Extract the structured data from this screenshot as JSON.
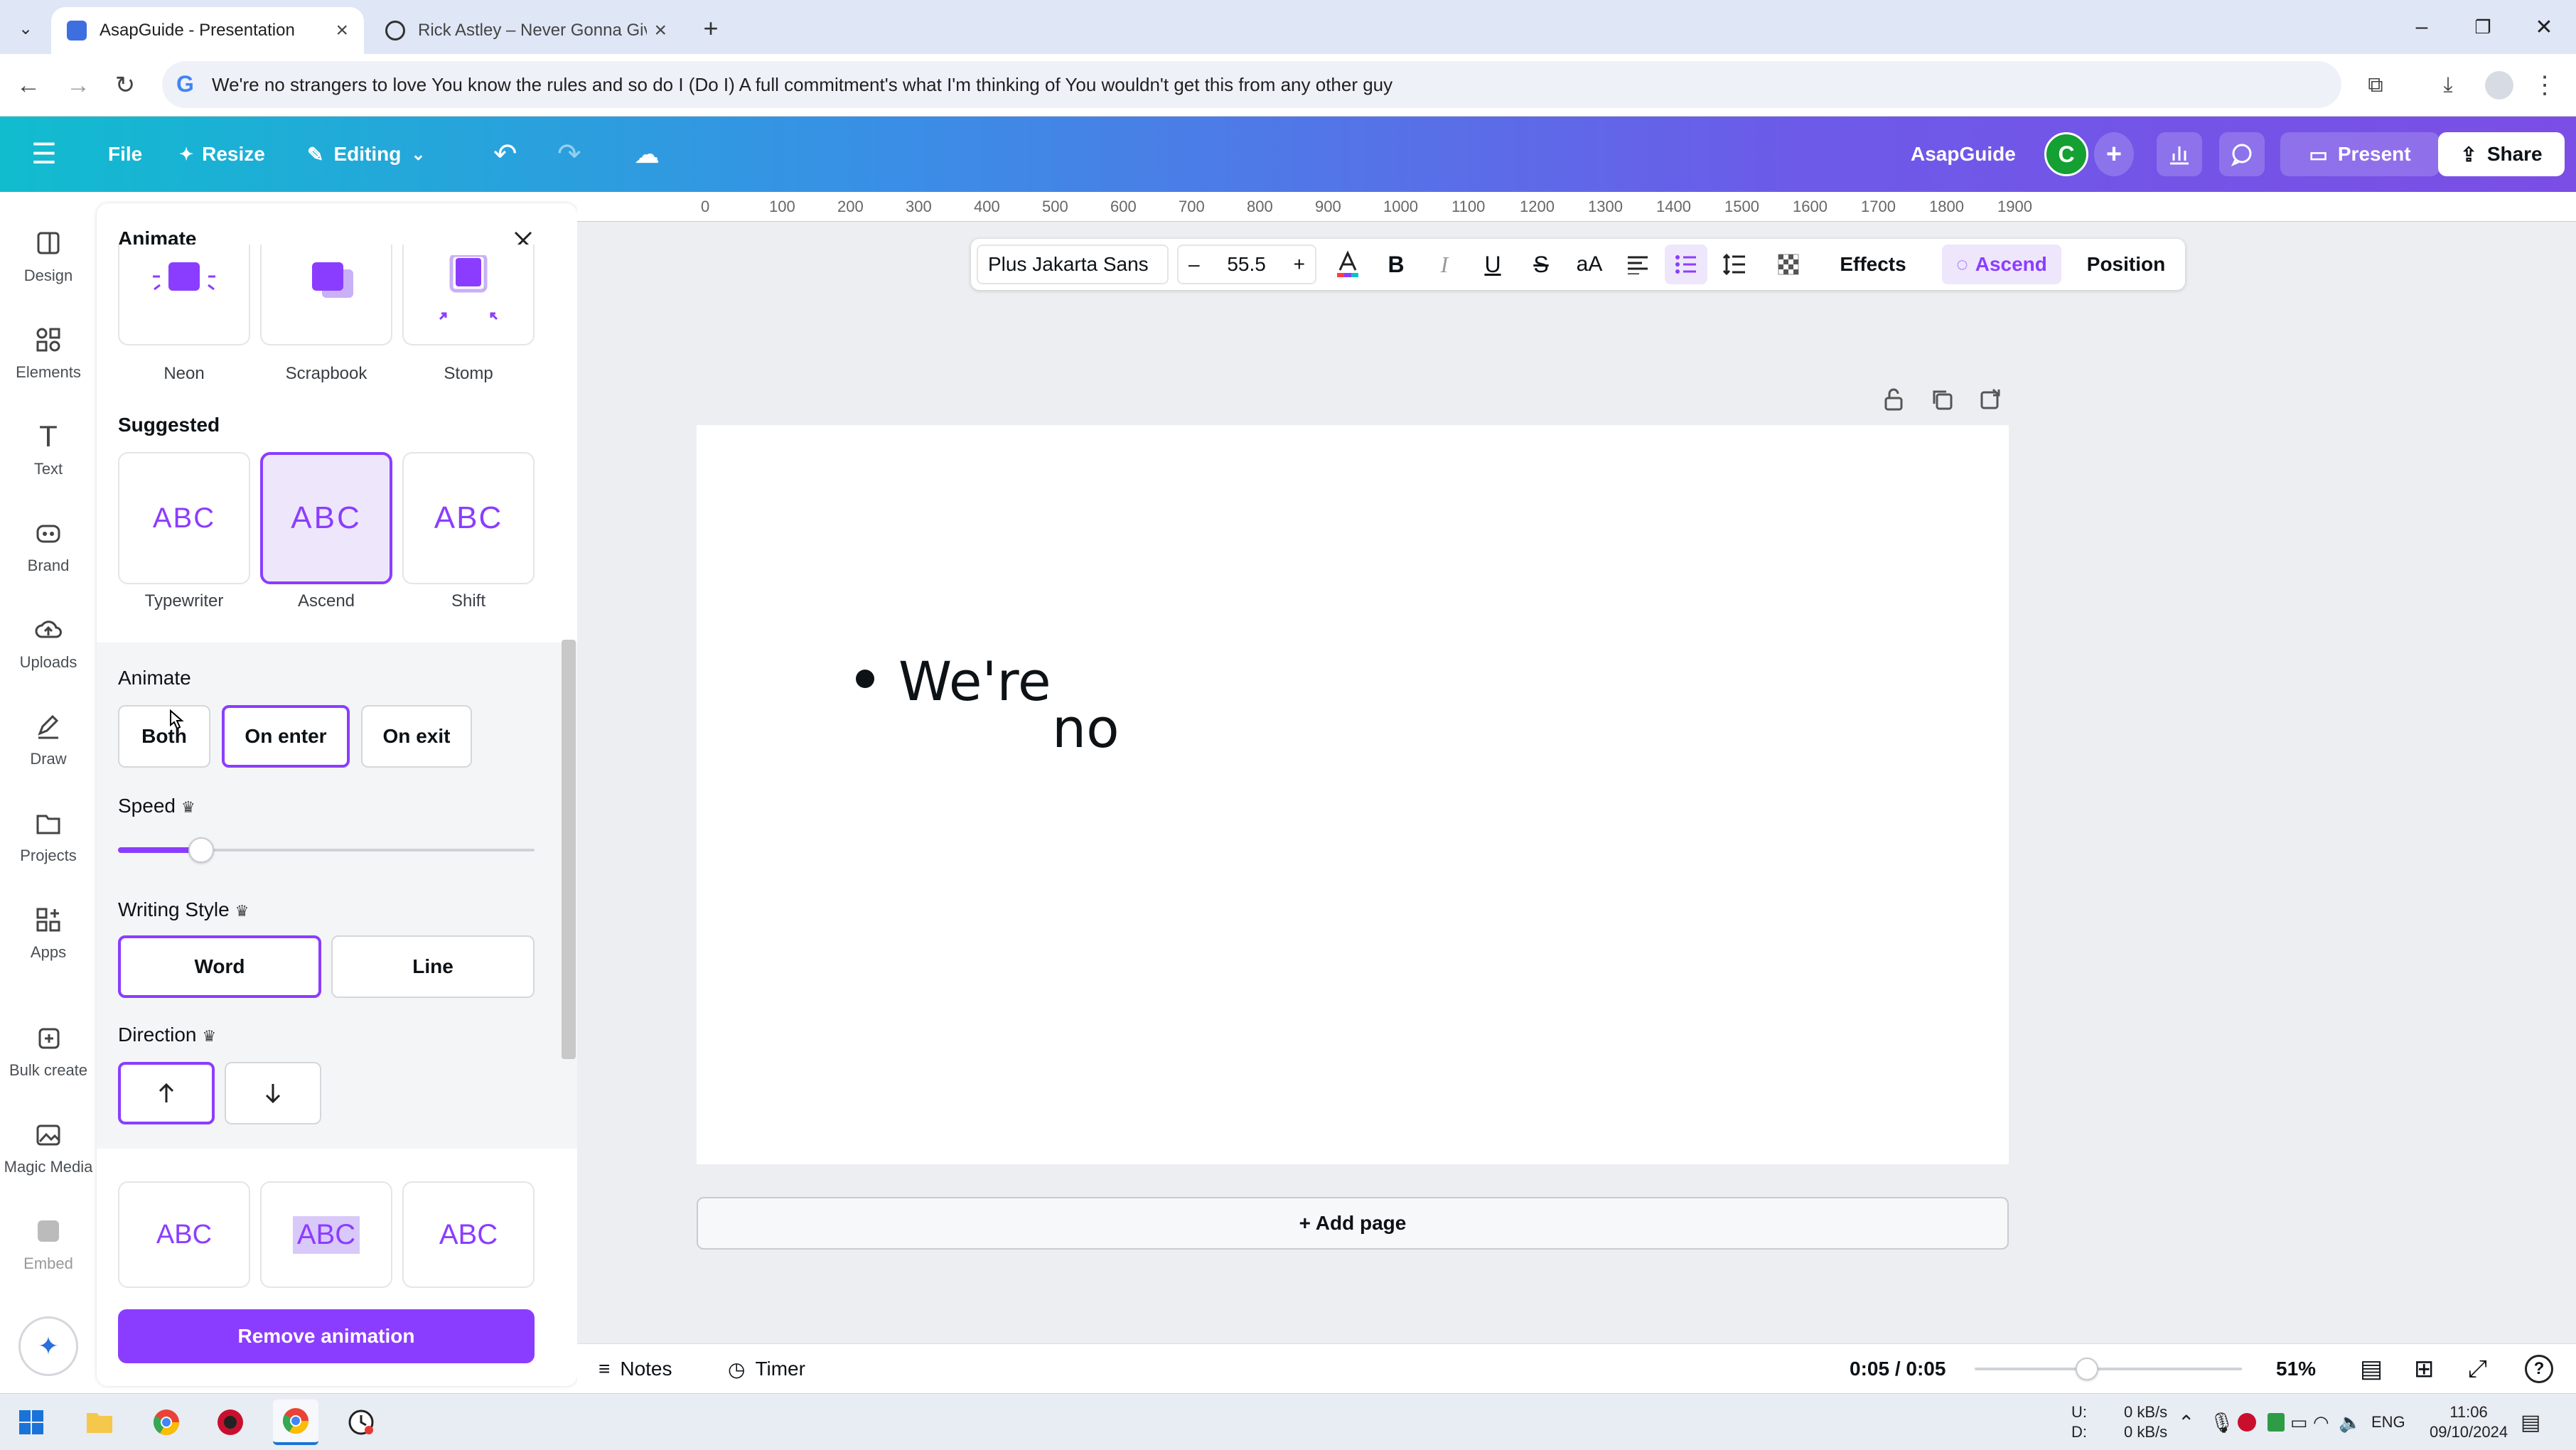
{
  "browser": {
    "tabs": [
      {
        "title": "AsapGuide - Presentation",
        "active": true
      },
      {
        "title": "Rick Astley – Never Gonna Give",
        "active": false
      }
    ],
    "address": "We're no strangers to love You know the rules and so do I (Do I) A full commitment's what I'm thinking of You wouldn't get this from any other guy"
  },
  "header": {
    "file": "File",
    "resize": "Resize",
    "editing": "Editing",
    "project_name": "AsapGuide",
    "avatar_initial": "C",
    "present": "Present",
    "share": "Share"
  },
  "rail": [
    {
      "label": "Design",
      "icon": "design-icon"
    },
    {
      "label": "Elements",
      "icon": "elements-icon"
    },
    {
      "label": "Text",
      "icon": "text-icon"
    },
    {
      "label": "Brand",
      "icon": "brand-icon"
    },
    {
      "label": "Uploads",
      "icon": "uploads-icon"
    },
    {
      "label": "Draw",
      "icon": "draw-icon"
    },
    {
      "label": "Projects",
      "icon": "projects-icon"
    },
    {
      "label": "Apps",
      "icon": "apps-icon"
    },
    {
      "label": "Bulk create",
      "icon": "bulk-create-icon"
    },
    {
      "label": "Magic Media",
      "icon": "magic-media-icon"
    },
    {
      "label": "Embed",
      "icon": "embed-icon"
    }
  ],
  "panel": {
    "title": "Animate",
    "top_effects": [
      "Neon",
      "Scrapbook",
      "Stomp"
    ],
    "suggested_label": "Suggested",
    "suggested": [
      {
        "label": "Typewriter",
        "preview": "ABC"
      },
      {
        "label": "Ascend",
        "preview": "ABC"
      },
      {
        "label": "Shift",
        "preview": "ABC"
      }
    ],
    "animate_label": "Animate",
    "animate_options": [
      "Both",
      "On enter",
      "On exit"
    ],
    "speed_label": "Speed",
    "speed_value": 0.2,
    "writing_style_label": "Writing Style",
    "writing_options": [
      "Word",
      "Line"
    ],
    "direction_label": "Direction",
    "bottom_previews": [
      "ABC",
      "ABC",
      "ABC"
    ],
    "remove_label": "Remove animation"
  },
  "ruler": [
    "0",
    "100",
    "200",
    "300",
    "400",
    "500",
    "600",
    "700",
    "800",
    "900",
    "1000",
    "1100",
    "1200",
    "1300",
    "1400",
    "1500",
    "1600",
    "1700",
    "1800",
    "1900"
  ],
  "toolbar": {
    "font": "Plus Jakarta Sans",
    "size": "55.5",
    "effects": "Effects",
    "animation": "Ascend",
    "position": "Position"
  },
  "canvas": {
    "word1": "We're",
    "word2": "no"
  },
  "add_page": "+ Add page",
  "bottom": {
    "notes": "Notes",
    "timer": "Timer",
    "time": "0:05 / 0:05",
    "timeline_value": 0.42,
    "zoom": "51%"
  },
  "taskbar": {
    "net_up": "0 kB/s",
    "net_down": "0 kB/s",
    "up_label": "U:",
    "down_label": "D:",
    "lang": "ENG",
    "time": "11:06",
    "date": "09/10/2024"
  },
  "colors": {
    "accent": "#8b3dff",
    "header_start": "#11bccf",
    "header_end": "#7b4ee6"
  }
}
